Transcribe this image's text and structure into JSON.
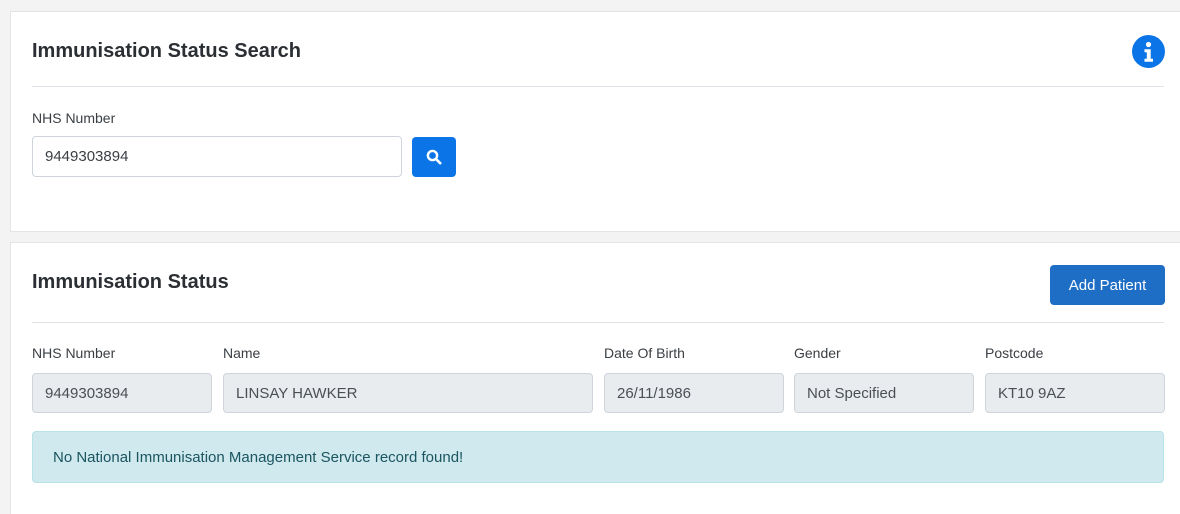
{
  "search_card": {
    "title": "Immunisation Status Search",
    "info_icon": "info-circle-icon",
    "nhs_label": "NHS Number",
    "nhs_value": "9449303894",
    "search_icon": "search-icon"
  },
  "status_card": {
    "title": "Immunisation Status",
    "add_patient_label": "Add Patient",
    "columns": [
      {
        "label": "NHS Number",
        "value": "9449303894"
      },
      {
        "label": "Name",
        "value": "LINSAY HAWKER"
      },
      {
        "label": "Date Of Birth",
        "value": "26/11/1986"
      },
      {
        "label": "Gender",
        "value": "Not Specified"
      },
      {
        "label": "Postcode",
        "value": "KT10 9AZ"
      }
    ],
    "alert_text": "No National Immunisation Management Service record found!"
  },
  "colors": {
    "primary": "#0b75e8",
    "add_patient": "#1f6ec6",
    "alert_bg": "#cfe9ee",
    "readonly_bg": "#e9ecef"
  }
}
